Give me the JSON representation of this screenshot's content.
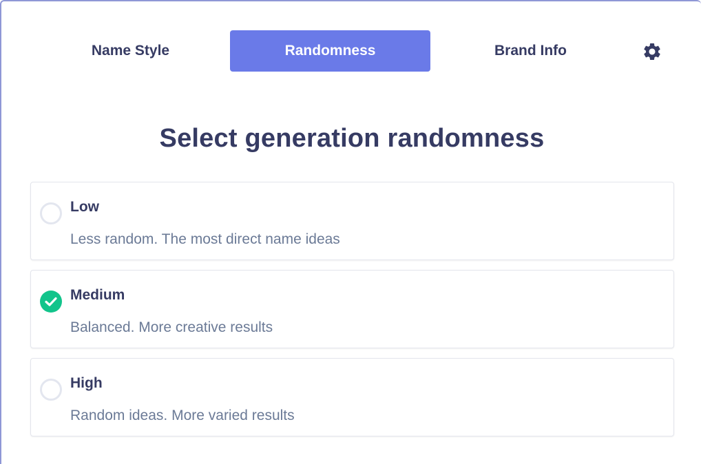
{
  "tabs": [
    {
      "label": "Name Style",
      "active": false
    },
    {
      "label": "Randomness",
      "active": true
    },
    {
      "label": "Brand Info",
      "active": false
    }
  ],
  "settings_icon": "gear-icon",
  "heading": "Select generation randomness",
  "options": [
    {
      "title": "Low",
      "description": "Less random. The most direct name ideas",
      "selected": false
    },
    {
      "title": "Medium",
      "description": "Balanced. More creative results",
      "selected": true
    },
    {
      "title": "High",
      "description": "Random ideas. More varied results",
      "selected": false
    }
  ],
  "colors": {
    "accent": "#6a7ae8",
    "text": "#363b63",
    "muted": "#6b7a96",
    "selected": "#12c48b"
  }
}
